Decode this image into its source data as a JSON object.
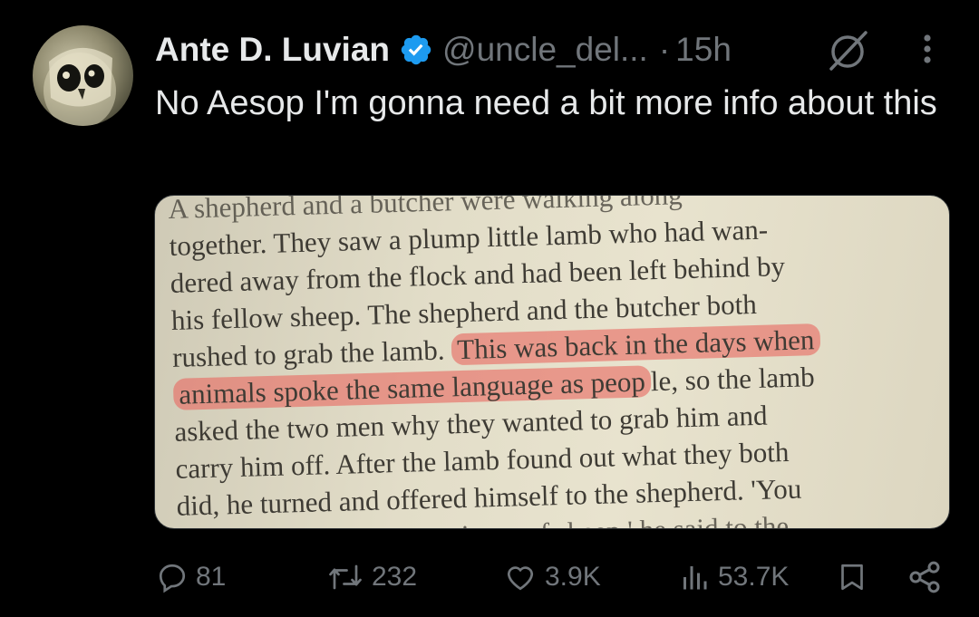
{
  "author": {
    "name": "Ante D. Luvian",
    "handle": "@uncle_del...",
    "separator": "·",
    "time": "15h",
    "avatar_icon": "owl-mask-avatar",
    "verified_color": "#1d9bf0"
  },
  "tweet": {
    "text": "No Aesop I'm gonna need a bit more info about this"
  },
  "media": {
    "lines": [
      {
        "text": "A shepherd and a butcher were walking along"
      },
      {
        "text": "together. They saw a plump little lamb who had wan-"
      },
      {
        "text": "dered away from the flock and had been left behind by"
      },
      {
        "text": "his fellow sheep. The shepherd and the butcher both"
      },
      {
        "pre": "rushed to grab the lamb. ",
        "hl": "This was back in the days when"
      },
      {
        "hl": "animals spoke the same language as peop",
        "post": "le, so the lamb"
      },
      {
        "text": "asked the two men why they wanted to grab him and"
      },
      {
        "text": "carry him off. After the lamb found out what they both"
      },
      {
        "text": "did, he turned and offered himself to the shepherd. 'You"
      },
      {
        "text": "are nothing but an executioner of sheep,' he said to the"
      }
    ],
    "highlight_color": "#e86a62"
  },
  "actions": {
    "replies": "81",
    "reposts": "232",
    "likes": "3.9K",
    "views": "53.7K",
    "icon_color": "#71767b"
  }
}
